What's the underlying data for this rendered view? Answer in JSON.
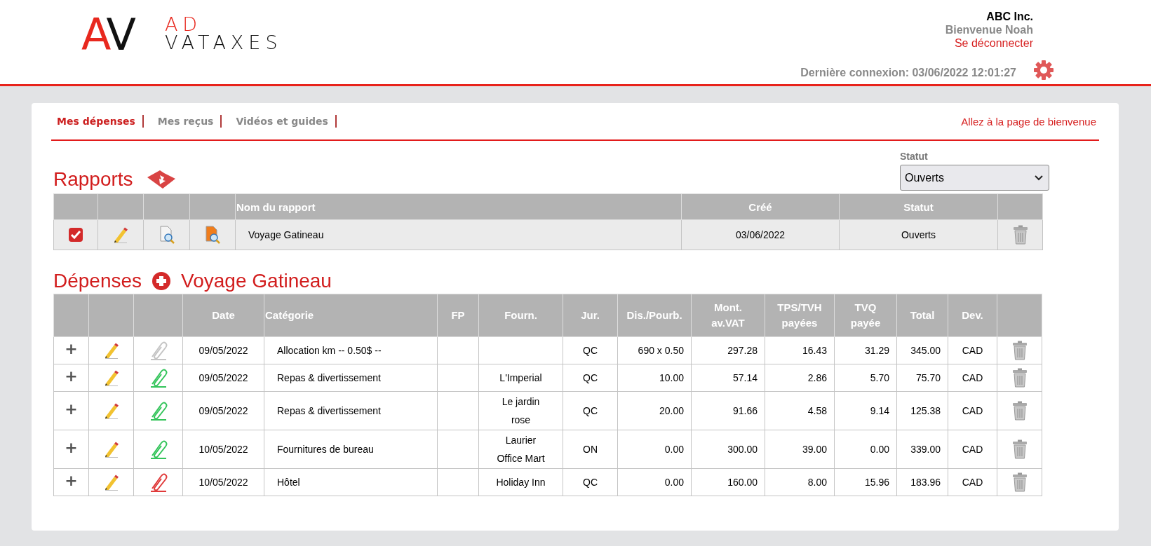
{
  "header": {
    "logo": {
      "mark_left": "A",
      "mark_right": "V",
      "line1": "AD",
      "line2": "VATAXES"
    },
    "company": "ABC Inc.",
    "welcome": "Bienvenue Noah",
    "logout": "Se déconnecter",
    "last_login": "Dernière connexion: 03/06/2022 12:01:27"
  },
  "nav": {
    "tabs": [
      {
        "label": "Mes dépenses",
        "selected": true
      },
      {
        "label": "Mes reçus",
        "selected": false
      },
      {
        "label": "Vidéos et guides",
        "selected": false
      }
    ],
    "welcome_link": "Allez à la page de bienvenue"
  },
  "reports": {
    "title": "Rapports",
    "status_filter": {
      "label": "Statut",
      "value": "Ouverts"
    },
    "columns": [
      "Nom du rapport",
      "Créé",
      "Statut"
    ],
    "rows": [
      {
        "name": "Voyage Gatineau",
        "created": "03/06/2022",
        "status": "Ouverts"
      }
    ]
  },
  "expenses": {
    "title": "Dépenses",
    "report_name": "Voyage Gatineau",
    "columns": [
      "Date",
      "Catégorie",
      "FP",
      "Fourn.",
      "Jur.",
      "Dis./Pourb.",
      "Mont.\nav.VAT",
      "TPS/TVH\npayées",
      "TVQ\npayée",
      "Total",
      "Dev."
    ],
    "rows": [
      {
        "expand": "+",
        "color": "#c4c4c4",
        "date": "09/05/2022",
        "category": "Allocation km -- 0.50$ --",
        "supplier": "",
        "jur": "QC",
        "dis": "690 x 0.50",
        "amount": "297.28",
        "tps": "16.43",
        "tvq": "31.29",
        "total": "345.00",
        "currency": "CAD"
      },
      {
        "expand": "+",
        "color": "#33c45a",
        "date": "09/05/2022",
        "category": "Repas & divertissement",
        "supplier": "L'Imperial",
        "jur": "QC",
        "dis": "10.00",
        "amount": "57.14",
        "tps": "2.86",
        "tvq": "5.70",
        "total": "75.70",
        "currency": "CAD"
      },
      {
        "expand": "+",
        "color": "#33c45a",
        "date": "09/05/2022",
        "category": "Repas & divertissement",
        "supplier": "Le jardin\nrose",
        "jur": "QC",
        "dis": "20.00",
        "amount": "91.66",
        "tps": "4.58",
        "tvq": "9.14",
        "total": "125.38",
        "currency": "CAD"
      },
      {
        "expand": "+",
        "color": "#33c45a",
        "date": "10/05/2022",
        "category": "Fournitures de bureau",
        "supplier": "Laurier\nOffice Mart",
        "jur": "ON",
        "dis": "0.00",
        "amount": "300.00",
        "tps": "39.00",
        "tvq": "0.00",
        "total": "339.00",
        "currency": "CAD"
      },
      {
        "expand": "+",
        "color": "#e03a3a",
        "date": "10/05/2022",
        "category": "Hôtel",
        "supplier": "Holiday Inn",
        "jur": "QC",
        "dis": "0.00",
        "amount": "160.00",
        "tps": "8.00",
        "tvq": "15.96",
        "total": "183.96",
        "currency": "CAD"
      }
    ]
  }
}
